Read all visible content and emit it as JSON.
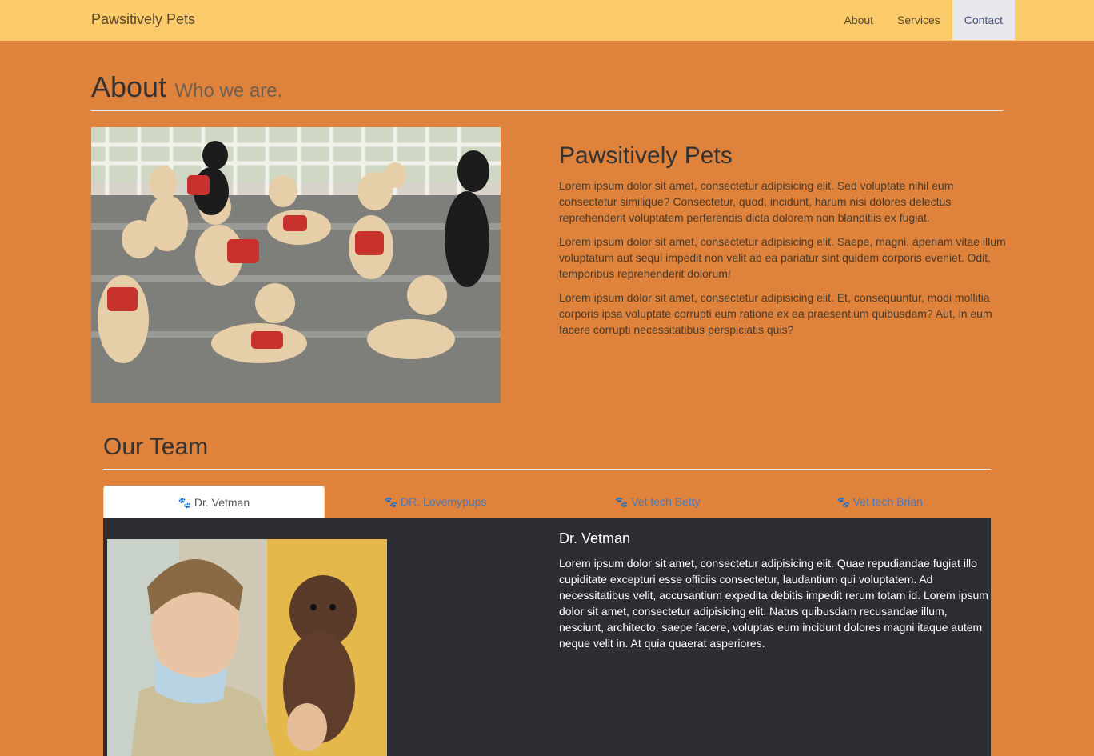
{
  "navbar": {
    "brand": "Pawsitively Pets",
    "links": [
      "About",
      "Services",
      "Contact"
    ],
    "active": "Contact"
  },
  "about": {
    "title": "About",
    "subtitle": "Who we are.",
    "heading": "Pawsitively Pets",
    "paragraphs": [
      "Lorem ipsum dolor sit amet, consectetur adipisicing elit. Sed voluptate nihil eum consectetur similique? Consectetur, quod, incidunt, harum nisi dolores delectus reprehenderit voluptatem perferendis dicta dolorem non blanditiis ex fugiat.",
      "Lorem ipsum dolor sit amet, consectetur adipisicing elit. Saepe, magni, aperiam vitae illum voluptatum aut sequi impedit non velit ab ea pariatur sint quidem corporis eveniet. Odit, temporibus reprehenderit dolorum!",
      "Lorem ipsum dolor sit amet, consectetur adipisicing elit. Et, consequuntur, modi mollitia corporis ipsa voluptate corrupti eum ratione ex ea praesentium quibusdam? Aut, in eum facere corrupti necessitatibus perspiciatis quis?"
    ]
  },
  "team": {
    "title": "Our Team",
    "tabs": [
      "Dr. Vetman",
      "DR. Lovemypups",
      "Vet tech Betty",
      "Vet tech Brian"
    ],
    "active_member": {
      "name": "Dr. Vetman",
      "bio": "Lorem ipsum dolor sit amet, consectetur adipisicing elit. Quae repudiandae fugiat illo cupiditate excepturi esse officiis consectetur, laudantium qui voluptatem. Ad necessitatibus velit, accusantium expedita debitis impedit rerum totam id. Lorem ipsum dolor sit amet, consectetur adipisicing elit. Natus quibusdam recusandae illum, nesciunt, architecto, saepe facere, voluptas eum incidunt dolores magni itaque autem neque velit in. At quia quaerat asperiores."
    }
  },
  "colors": {
    "background": "#df823c",
    "navbar": "#fbca6b",
    "panel": "#2d2e34",
    "tab_link": "#4a7ab8"
  }
}
